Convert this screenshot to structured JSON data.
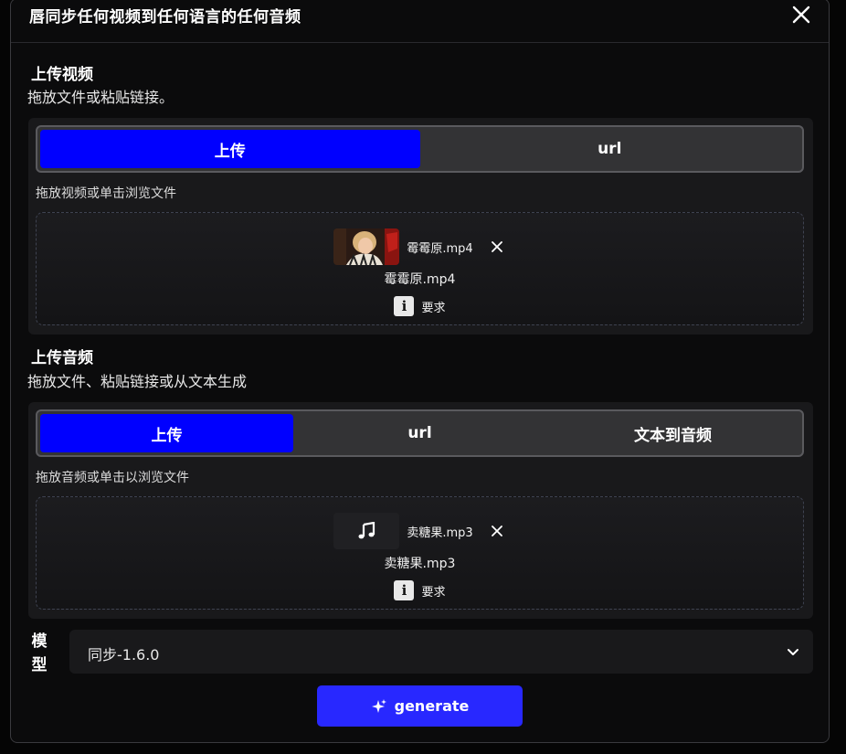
{
  "window": {
    "title": "唇同步任何视频到任何语言的任何音频",
    "close_icon": "close-icon"
  },
  "video_section": {
    "title": "上传视频",
    "subtitle": "拖放文件或粘贴链接。",
    "tabs": [
      {
        "label": "上传",
        "active": true
      },
      {
        "label": "url",
        "active": false
      }
    ],
    "drop_hint": "拖放视频或单击浏览文件",
    "file": {
      "chip_name": "霉霉原.mp4",
      "caption": "霉霉原.mp4",
      "thumbnail_icon": "video-thumbnail"
    },
    "requirements_label": "要求"
  },
  "audio_section": {
    "title": "上传音频",
    "subtitle": "拖放文件、粘贴链接或从文本生成",
    "tabs": [
      {
        "label": "上传",
        "active": true
      },
      {
        "label": "url",
        "active": false
      },
      {
        "label": "文本到音频",
        "active": false
      }
    ],
    "drop_hint": "拖放音频或单击以浏览文件",
    "file": {
      "chip_name": "卖糖果.mp3",
      "caption": "卖糖果.mp3",
      "thumbnail_icon": "music-note-icon"
    },
    "requirements_label": "要求"
  },
  "model": {
    "label": "模型",
    "selected": "同步-1.6.0"
  },
  "generate_button": {
    "label": "generate",
    "icon": "sparkle-icon"
  },
  "colors": {
    "accent": "#0000ff",
    "button": "#2828ff",
    "background": "#0b0b0c",
    "panel": "#19191b"
  }
}
